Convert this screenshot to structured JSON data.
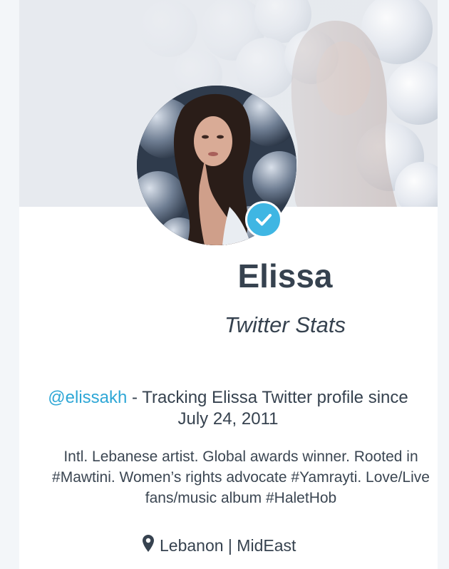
{
  "profile": {
    "name": "Elissa",
    "subtitle": "Twitter Stats",
    "handle": "@elissakh",
    "tracking_text": " - Tracking Elissa Twitter profile since",
    "tracking_date": "July 24, 2011",
    "bio_lines": [
      "Intl. Lebanese artist. Global awards winner. Rooted in",
      "#Mawtini. Women’s rights advocate #Yamrayti. Love/Live",
      "fans/music album #HaletHob"
    ],
    "location": "Lebanon | MidEast",
    "verified": true
  },
  "icons": {
    "verified": "checkmark-badge-icon",
    "location": "map-pin-icon"
  },
  "colors": {
    "accent": "#2ea7d6",
    "verified_badge": "#3fb6e3",
    "text": "#36424f"
  }
}
